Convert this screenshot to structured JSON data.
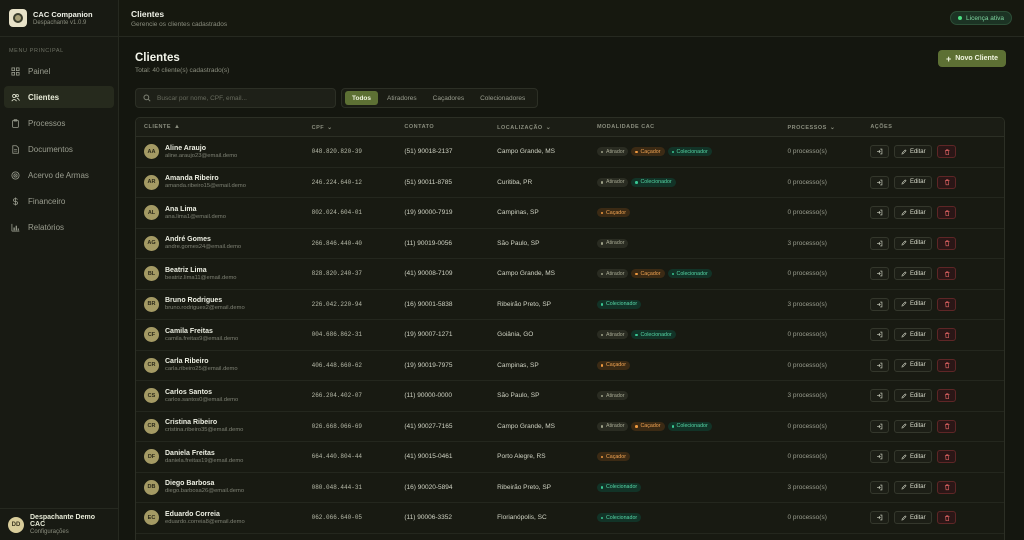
{
  "brand": {
    "name": "CAC Companion",
    "version": "Despachante v1.0.9"
  },
  "sidebar": {
    "heading": "MENU PRINCIPAL",
    "items": [
      {
        "label": "Painel",
        "icon": "grid-icon"
      },
      {
        "label": "Clientes",
        "icon": "users-icon",
        "active": true
      },
      {
        "label": "Processos",
        "icon": "clipboard-icon"
      },
      {
        "label": "Documentos",
        "icon": "file-icon"
      },
      {
        "label": "Acervo de Armas",
        "icon": "target-icon"
      },
      {
        "label": "Financeiro",
        "icon": "dollar-icon"
      },
      {
        "label": "Relatórios",
        "icon": "chart-icon"
      }
    ],
    "user": {
      "initials": "DD",
      "name": "Despachante Demo CAC",
      "sub": "Configurações"
    }
  },
  "topbar": {
    "title": "Clientes",
    "subtitle": "Gerencie os clientes cadastrados",
    "license": "Licença ativa"
  },
  "main": {
    "title": "Clientes",
    "subtitle": "Total: 40 cliente(s) cadastrado(s)",
    "new_button": "Novo Cliente",
    "search_placeholder": "Buscar por nome, CPF, email...",
    "filters": [
      "Todos",
      "Atiradores",
      "Caçadores",
      "Colecionadores"
    ],
    "active_filter": "Todos"
  },
  "table": {
    "headers": {
      "client": "CLIENTE",
      "cpf": "CPF",
      "contact": "CONTATO",
      "location": "LOCALIZAÇÃO",
      "modality": "MODALIDADE CAC",
      "processes": "PROCESSOS",
      "actions": "AÇÕES"
    },
    "edit_label": "Editar",
    "badge_labels": {
      "atirador": "Atirador",
      "cacador": "Caçador",
      "colecionador": "Colecionador"
    },
    "rows": [
      {
        "initials": "AA",
        "name": "Aline Araujo",
        "email": "aline.araujo23@email.demo",
        "cpf": "048.820.820-39",
        "contact": "(51) 90018-2137",
        "location": "Campo Grande, MS",
        "badges": [
          "atirador",
          "cacador",
          "colecionador"
        ],
        "processes": "0 processo(s)"
      },
      {
        "initials": "AR",
        "name": "Amanda Ribeiro",
        "email": "amanda.ribeiro15@email.demo",
        "cpf": "246.224.640-12",
        "contact": "(51) 90011-8785",
        "location": "Curitiba, PR",
        "badges": [
          "atirador",
          "colecionador"
        ],
        "processes": "0 processo(s)"
      },
      {
        "initials": "AL",
        "name": "Ana Lima",
        "email": "ana.lima1@email.demo",
        "cpf": "802.024.604-01",
        "contact": "(19) 90000-7919",
        "location": "Campinas, SP",
        "badges": [
          "cacador"
        ],
        "processes": "0 processo(s)"
      },
      {
        "initials": "AG",
        "name": "André Gomes",
        "email": "andre.gomes24@email.demo",
        "cpf": "266.846.440-40",
        "contact": "(11) 90019-0056",
        "location": "São Paulo, SP",
        "badges": [
          "atirador"
        ],
        "processes": "3 processo(s)"
      },
      {
        "initials": "BL",
        "name": "Beatriz Lima",
        "email": "beatriz.lima11@email.demo",
        "cpf": "828.820.240-37",
        "contact": "(41) 90008-7109",
        "location": "Campo Grande, MS",
        "badges": [
          "atirador",
          "cacador",
          "colecionador"
        ],
        "processes": "0 processo(s)"
      },
      {
        "initials": "BR",
        "name": "Bruno Rodrigues",
        "email": "bruno.rodrigues2@email.demo",
        "cpf": "226.042.220-94",
        "contact": "(16) 90001-5838",
        "location": "Ribeirão Preto, SP",
        "badges": [
          "colecionador"
        ],
        "processes": "3 processo(s)"
      },
      {
        "initials": "CF",
        "name": "Camila Freitas",
        "email": "camila.freitas9@email.demo",
        "cpf": "004.686.862-31",
        "contact": "(19) 90007-1271",
        "location": "Goiânia, GO",
        "badges": [
          "atirador",
          "colecionador"
        ],
        "processes": "0 processo(s)"
      },
      {
        "initials": "CR",
        "name": "Carla Ribeiro",
        "email": "carla.ribeiro25@email.demo",
        "cpf": "406.448.660-62",
        "contact": "(19) 90019-7975",
        "location": "Campinas, SP",
        "badges": [
          "cacador"
        ],
        "processes": "0 processo(s)"
      },
      {
        "initials": "CS",
        "name": "Carlos Santos",
        "email": "carlos.santos0@email.demo",
        "cpf": "266.204.402-07",
        "contact": "(11) 90000-0000",
        "location": "São Paulo, SP",
        "badges": [
          "atirador"
        ],
        "processes": "3 processo(s)"
      },
      {
        "initials": "CR",
        "name": "Cristina Ribeiro",
        "email": "cristina.ribeiro35@email.demo",
        "cpf": "026.668.066-69",
        "contact": "(41) 90027-7165",
        "location": "Campo Grande, MS",
        "badges": [
          "atirador",
          "cacador",
          "colecionador"
        ],
        "processes": "0 processo(s)"
      },
      {
        "initials": "DF",
        "name": "Daniela Freitas",
        "email": "daniela.freitas19@email.demo",
        "cpf": "664.440.804-44",
        "contact": "(41) 90015-0461",
        "location": "Porto Alegre, RS",
        "badges": [
          "cacador"
        ],
        "processes": "0 processo(s)"
      },
      {
        "initials": "DB",
        "name": "Diego Barbosa",
        "email": "diego.barbosa26@email.demo",
        "cpf": "080.048.444-31",
        "contact": "(16) 90020-5894",
        "location": "Ribeirão Preto, SP",
        "badges": [
          "colecionador"
        ],
        "processes": "3 processo(s)"
      },
      {
        "initials": "EC",
        "name": "Eduardo Correia",
        "email": "eduardo.correia8@email.demo",
        "cpf": "062.066.640-05",
        "contact": "(11) 90006-3352",
        "location": "Florianópolis, SC",
        "badges": [
          "colecionador"
        ],
        "processes": "0 processo(s)"
      }
    ]
  }
}
